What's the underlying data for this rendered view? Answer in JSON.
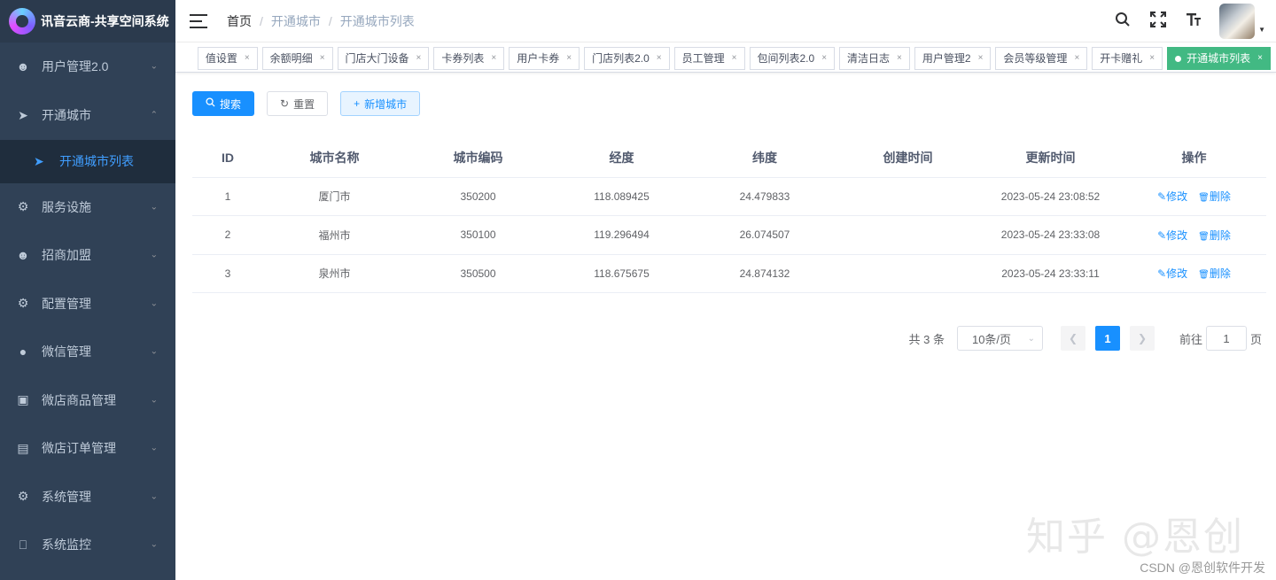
{
  "sidebar": {
    "logo_text": "讯音云商-共享空间系统",
    "items": [
      {
        "label": "用户管理2.0",
        "icon": "user-icon"
      },
      {
        "label": "开通城市",
        "icon": "send-icon"
      },
      {
        "label": "服务设施",
        "icon": "gear-icon"
      },
      {
        "label": "招商加盟",
        "icon": "user-icon"
      },
      {
        "label": "配置管理",
        "icon": "gear-icon"
      },
      {
        "label": "微信管理",
        "icon": "wechat-icon"
      },
      {
        "label": "微店商品管理",
        "icon": "shop-icon"
      },
      {
        "label": "微店订单管理",
        "icon": "document-icon"
      },
      {
        "label": "系统管理",
        "icon": "gear-icon"
      },
      {
        "label": "系统监控",
        "icon": "monitor-icon"
      }
    ],
    "sub_active": "开通城市列表"
  },
  "breadcrumb": {
    "home": "首页",
    "level1": "开通城市",
    "level2": "开通城市列表"
  },
  "tags": [
    {
      "label": "值设置"
    },
    {
      "label": "余额明细"
    },
    {
      "label": "门店大门设备"
    },
    {
      "label": "卡券列表"
    },
    {
      "label": "用户卡券"
    },
    {
      "label": "门店列表2.0"
    },
    {
      "label": "员工管理"
    },
    {
      "label": "包间列表2.0"
    },
    {
      "label": "清洁日志"
    },
    {
      "label": "用户管理2"
    },
    {
      "label": "会员等级管理"
    },
    {
      "label": "开卡赠礼"
    },
    {
      "label": "开通城市列表",
      "active": true
    }
  ],
  "toolbar": {
    "search": "搜索",
    "reset": "重置",
    "add": "新增城市"
  },
  "table": {
    "columns": [
      "ID",
      "城市名称",
      "城市编码",
      "经度",
      "纬度",
      "创建时间",
      "更新时间",
      "操作"
    ],
    "rows": [
      {
        "id": "1",
        "name": "厦门市",
        "code": "350200",
        "lng": "118.089425",
        "lat": "24.479833",
        "created": "",
        "updated": "2023-05-24 23:08:52"
      },
      {
        "id": "2",
        "name": "福州市",
        "code": "350100",
        "lng": "119.296494",
        "lat": "26.074507",
        "created": "",
        "updated": "2023-05-24 23:33:08"
      },
      {
        "id": "3",
        "name": "泉州市",
        "code": "350500",
        "lng": "118.675675",
        "lat": "24.874132",
        "created": "",
        "updated": "2023-05-24 23:33:11"
      }
    ],
    "edit_label": "修改",
    "delete_label": "删除"
  },
  "pagination": {
    "total": "共 3 条",
    "page_size": "10条/页",
    "current": "1",
    "goto_prefix": "前往",
    "goto_value": "1",
    "goto_suffix": "页"
  },
  "watermark": "知乎 @恩创",
  "footer_credit": "CSDN @恩创软件开发",
  "colors": {
    "sidebar_bg": "#304156",
    "primary": "#1890ff",
    "active_tag": "#42b983"
  }
}
